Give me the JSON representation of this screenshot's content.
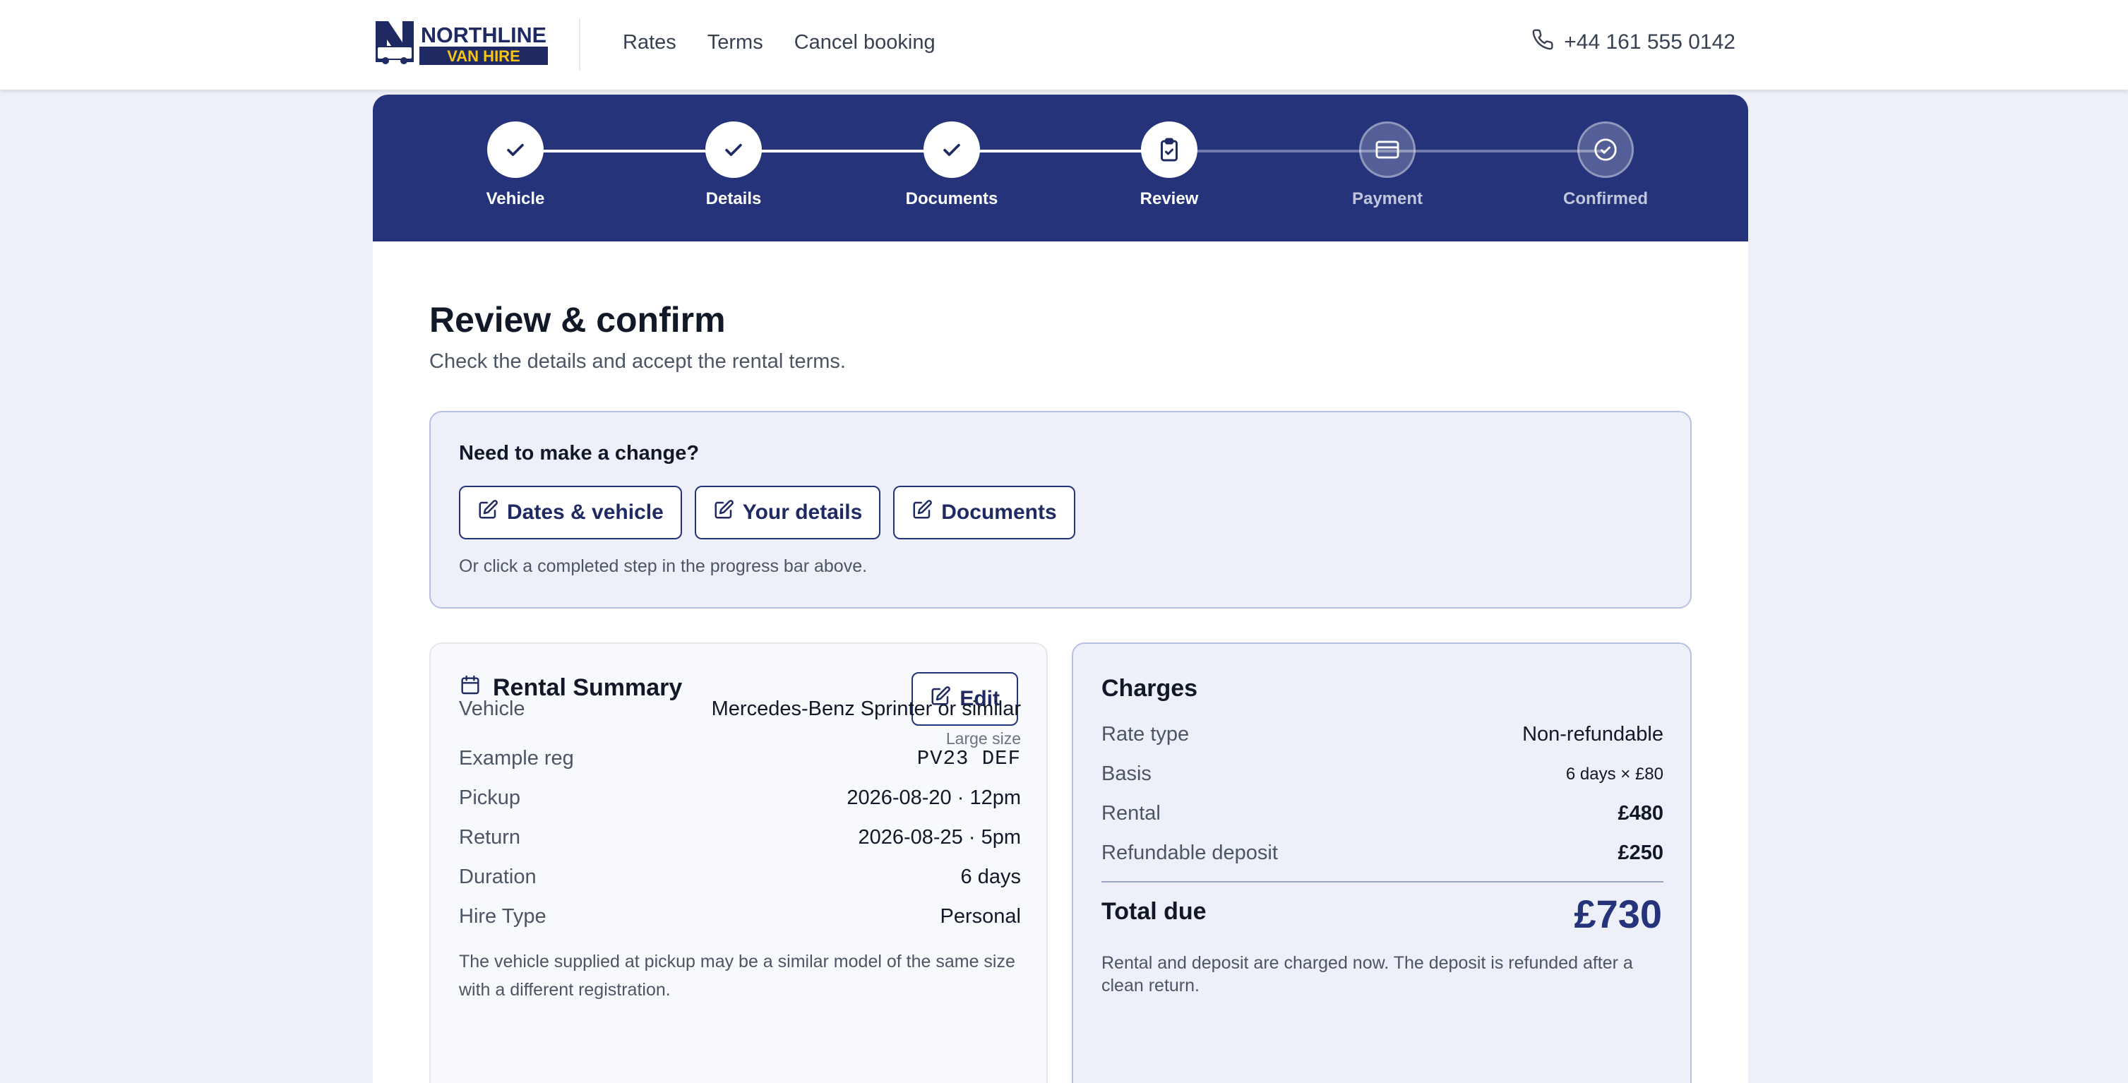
{
  "brand": {
    "name_line1": "NORTHLINE",
    "name_line2": "VAN HIRE"
  },
  "nav": {
    "items": [
      "Rates",
      "Terms",
      "Cancel booking"
    ]
  },
  "contact": {
    "phone": "+44 161 555 0142"
  },
  "stepper": {
    "steps": [
      {
        "label": "Vehicle",
        "state": "done",
        "icon": "check-icon"
      },
      {
        "label": "Details",
        "state": "done",
        "icon": "check-icon"
      },
      {
        "label": "Documents",
        "state": "done",
        "icon": "check-icon"
      },
      {
        "label": "Review",
        "state": "current",
        "icon": "clipboard-check-icon"
      },
      {
        "label": "Payment",
        "state": "future",
        "icon": "credit-card-icon"
      },
      {
        "label": "Confirmed",
        "state": "future",
        "icon": "check-circle-icon"
      }
    ]
  },
  "page": {
    "title": "Review & confirm",
    "subtitle": "Check the details and accept the rental terms."
  },
  "change": {
    "title": "Need to make a change?",
    "buttons": [
      "Dates & vehicle",
      "Your details",
      "Documents"
    ],
    "note": "Or click a completed step in the progress bar above."
  },
  "summary": {
    "title": "Rental Summary",
    "edit_label": "Edit",
    "rows": [
      {
        "key": "Vehicle",
        "value": "Mercedes-Benz Sprinter or similar",
        "sub": "Large size"
      },
      {
        "key": "Example reg",
        "value": "PV23 DEF"
      },
      {
        "key": "Pickup",
        "value": "2026-08-20 · 12pm"
      },
      {
        "key": "Return",
        "value": "2026-08-25 · 5pm"
      },
      {
        "key": "Duration",
        "value": "6 days"
      },
      {
        "key": "Hire Type",
        "value": "Personal"
      }
    ],
    "note": "The vehicle supplied at pickup may be a similar model of the same size with a different registration."
  },
  "charges": {
    "title": "Charges",
    "rows": [
      {
        "key": "Rate type",
        "value": "Non-refundable"
      },
      {
        "key": "Basis",
        "value": "6 days × £80"
      },
      {
        "key": "Rental",
        "value": "£480"
      },
      {
        "key": "Refundable deposit",
        "value": "£250"
      }
    ],
    "total_label": "Total due",
    "total_value": "£730",
    "note": "Rental and deposit are charged now. The deposit is refunded after a clean return."
  },
  "colors": {
    "brand_navy": "#24337a",
    "brand_yellow": "#f5c518",
    "page_bg": "#eef0f7"
  }
}
